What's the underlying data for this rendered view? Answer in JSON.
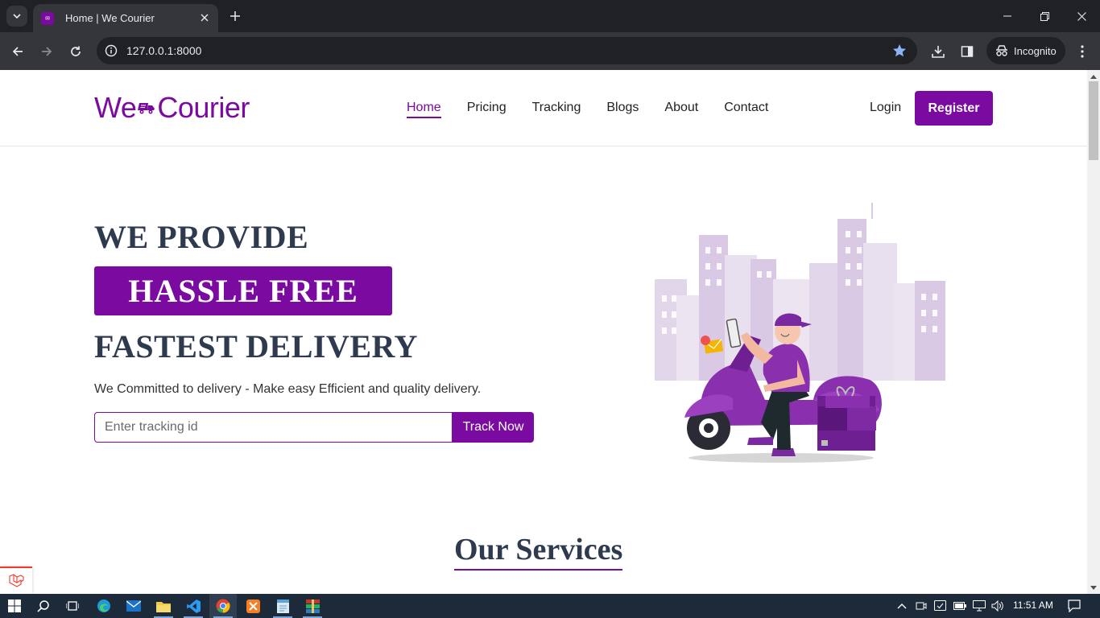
{
  "browser": {
    "tab_title": "Home | We Courier",
    "url": "127.0.0.1:8000",
    "profile_label": "Incognito"
  },
  "site": {
    "logo_left": "We",
    "logo_right": "Courier",
    "nav": [
      {
        "label": "Home",
        "active": true
      },
      {
        "label": "Pricing"
      },
      {
        "label": "Tracking"
      },
      {
        "label": "Blogs"
      },
      {
        "label": "About"
      },
      {
        "label": "Contact"
      }
    ],
    "login_label": "Login",
    "register_label": "Register",
    "brand_color": "#7a0aa0"
  },
  "hero": {
    "line1": "WE PROVIDE",
    "badge": "HASSLE FREE",
    "line3": "FASTEST DELIVERY",
    "subtitle": "We Committed to delivery - Make easy Efficient and quality delivery.",
    "track_placeholder": "Enter tracking id",
    "track_button": "Track Now"
  },
  "services": {
    "heading": "Our Services"
  },
  "taskbar": {
    "time": "11:51 AM"
  }
}
